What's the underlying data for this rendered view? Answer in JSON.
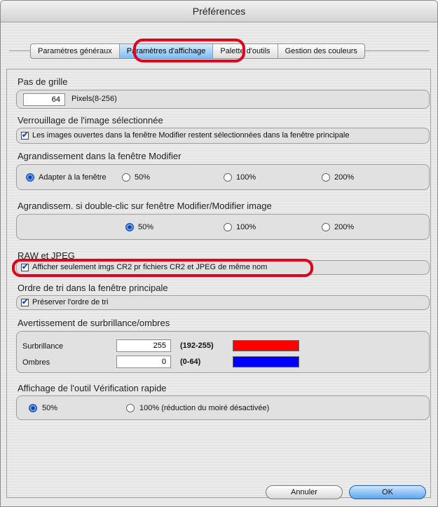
{
  "window": {
    "title": "Préférences"
  },
  "tabs": [
    {
      "label": "Paramètres généraux"
    },
    {
      "label": "Paramètres d'affichage"
    },
    {
      "label": "Palette d'outils"
    },
    {
      "label": "Gestion des couleurs"
    }
  ],
  "grid": {
    "title": "Pas de grille",
    "value": "64",
    "unit": "Pixels(8-256)"
  },
  "lock": {
    "title": "Verrouillage de l'image sélectionnée",
    "checkbox_label": "Les images ouvertes dans la fenêtre Modifier restent sélectionnées dans la fenêtre principale",
    "checked": true
  },
  "zoom_edit": {
    "title": "Agrandissement dans la fenêtre Modifier",
    "options": [
      "Adapter à la fenêtre",
      "50%",
      "100%",
      "200%"
    ],
    "selected": "Adapter à la fenêtre"
  },
  "zoom_dblclick": {
    "title": "Agrandissem. si double-clic sur fenêtre Modifier/Modifier image",
    "options": [
      "50%",
      "100%",
      "200%"
    ],
    "selected": "50%"
  },
  "raw": {
    "title": "RAW et JPEG",
    "checkbox_label": "Afficher seulement imgs CR2 pr fichiers CR2 et JPEG de même nom",
    "checked": true
  },
  "sort": {
    "title": "Ordre de tri dans la fenêtre principale",
    "checkbox_label": "Préserver l'ordre de tri",
    "checked": true
  },
  "warning": {
    "title": "Avertissement de surbrillance/ombres",
    "highlight_label": "Surbrillance",
    "highlight_value": "255",
    "highlight_range": "(192-255)",
    "highlight_color": "#ff0000",
    "shadow_label": "Ombres",
    "shadow_value": "0",
    "shadow_range": "(0-64)",
    "shadow_color": "#0000ff"
  },
  "quickcheck": {
    "title": "Affichage de l'outil Vérification rapide",
    "options": [
      "50%",
      "100% (réduction du moiré désactivée)"
    ],
    "selected": "50%"
  },
  "buttons": {
    "cancel": "Annuler",
    "ok": "OK"
  }
}
